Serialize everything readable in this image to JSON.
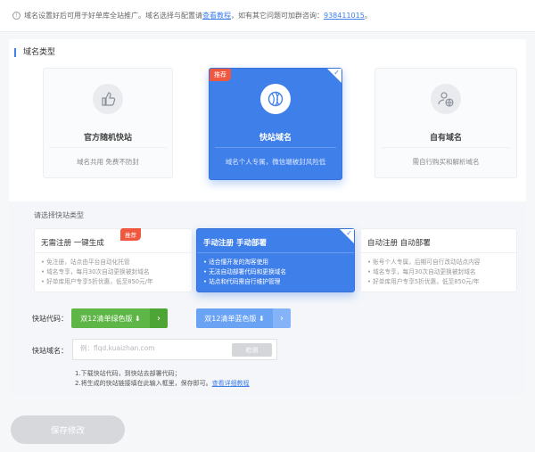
{
  "notice": {
    "text": "域名设置好后可用于好单库全站推广。域名选择与配置请",
    "link1": "查看教程",
    "text2": "，如有其它问题可加群咨询：",
    "group": "938411015",
    "end": "。"
  },
  "domain_type": {
    "section_title": "域名类型",
    "cards": [
      {
        "title": "官方随机快站",
        "sub": "域名共用 免费不防封",
        "icon": "thumbs-up-icon"
      },
      {
        "title": "快站域名",
        "sub": "域名个人专属，微信端被封风险低",
        "badge": "推荐",
        "icon": "volleyball-icon"
      },
      {
        "title": "自有域名",
        "sub": "需自行购买和解析域名",
        "icon": "user-globe-icon"
      }
    ]
  },
  "kuaizhan_type": {
    "label": "请选择快站类型",
    "cards": [
      {
        "title": "无需注册 一键生成",
        "badge": "推荐",
        "items": [
          "免注册，站点由平台自动化托管",
          "域名专享，每月30次自动更换被封域名",
          "好单库用户专享5折优惠，低至850元/年"
        ]
      },
      {
        "title": "手动注册 手动部署",
        "items": [
          "适合懂开发的淘客使用",
          "无法自动部署代码和更换域名",
          "站点和代码需自行维护管理"
        ]
      },
      {
        "title": "自动注册 自动部署",
        "items": [
          "账号个人专属，后期可自行改动站点内容",
          "域名专享，每月30次自动更换被封域名",
          "好单库用户专享5折优惠，低至850元/年"
        ]
      }
    ]
  },
  "code": {
    "label": "快站代码：",
    "green_btn": "双12清单绿色版",
    "blue_btn": "双12清单蓝色版"
  },
  "domain": {
    "label": "快站域名：",
    "placeholder": "例：flqd.kuaizhan.com",
    "check_btn": "检测"
  },
  "tips": {
    "line1": "1.下载快站代码，到快站去部署代码；",
    "line2": "2.将生成的快站链接填在此输入框里，保存即可。",
    "link": "查看详细教程"
  },
  "save_btn": "保存修改",
  "colors": {
    "accent": "#3f7fe9",
    "badge": "#f0573f",
    "green": "#5db645"
  }
}
